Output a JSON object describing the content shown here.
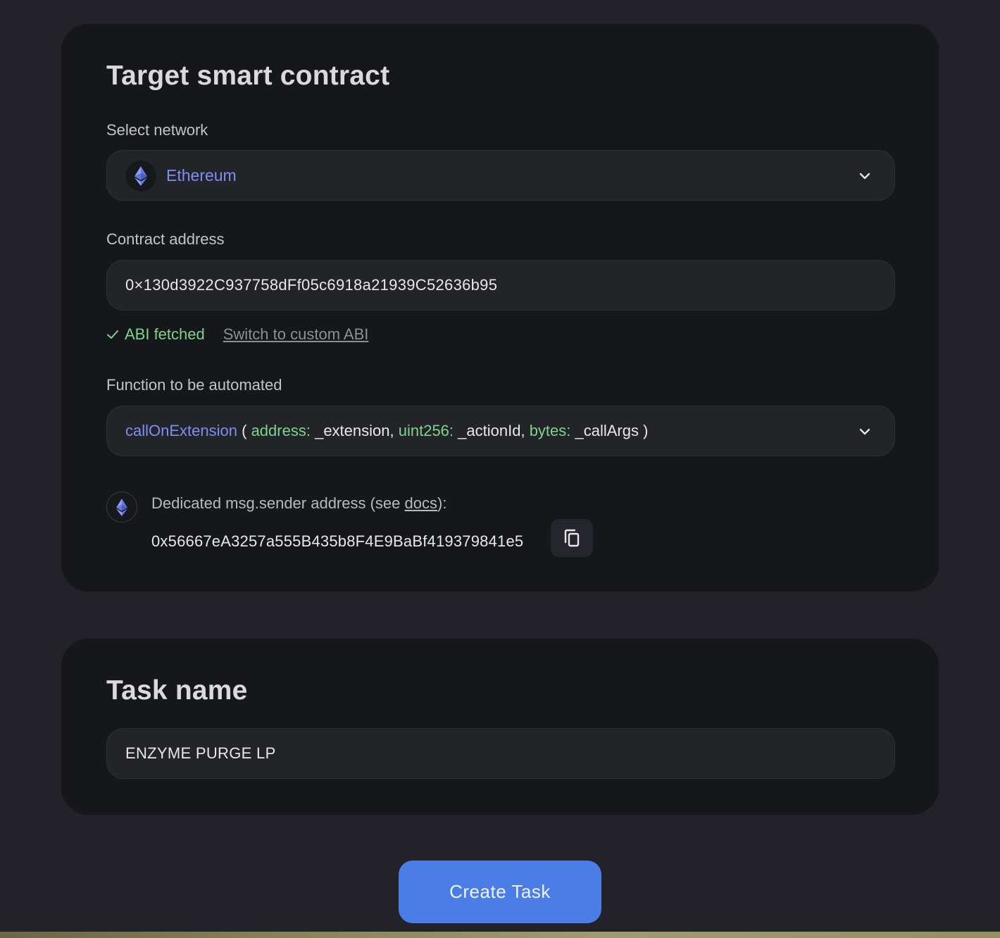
{
  "contract_card": {
    "title": "Target smart contract",
    "network_label": "Select network",
    "network_value": "Ethereum",
    "network_icon": "ethereum-icon",
    "address_label": "Contract address",
    "address_value": "0×130d3922C937758dFf05c6918a21939C52636b95",
    "abi_status": "ABI fetched",
    "abi_switch": "Switch to custom ABI",
    "function_label": "Function to be automated",
    "function": {
      "name": "callOnExtension",
      "open_paren": "(",
      "params": [
        {
          "type": "address:",
          "name": "_extension,"
        },
        {
          "type": "uint256:",
          "name": "_actionId,"
        },
        {
          "type": "bytes:",
          "name": "_callArgs"
        }
      ],
      "close_paren": ")"
    },
    "sender_text_prefix": "Dedicated msg.sender address (see ",
    "sender_docs_link": "docs",
    "sender_text_suffix": "):",
    "sender_address": "0x56667eA3257a555B435b8F4E9BaBf419379841e5"
  },
  "task_card": {
    "title": "Task name",
    "task_name_value": "ENZYME PURGE LP"
  },
  "actions": {
    "create_label": "Create Task"
  },
  "colors": {
    "accent": "#4a7ee6",
    "network_text": "#7d8ff2",
    "success": "#7fd38a",
    "background": "#232228",
    "card": "#16171b"
  }
}
